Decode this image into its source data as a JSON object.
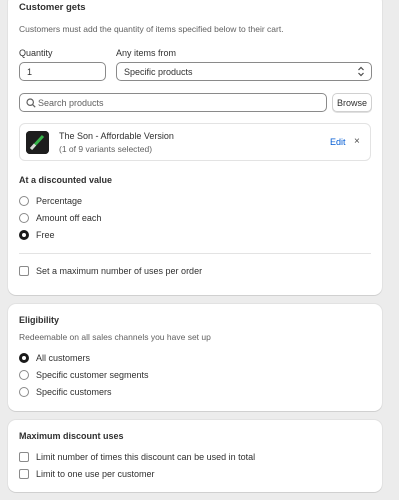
{
  "customer_gets": {
    "title": "Customer gets",
    "description": "Customers must add the quantity of items specified below to their cart.",
    "quantity_label": "Quantity",
    "quantity_value": "1",
    "any_items_label": "Any items from",
    "any_items_value": "Specific products",
    "search_placeholder": "Search products",
    "browse_label": "Browse",
    "product": {
      "name": "The Son - Affordable Version",
      "variants": "(1 of 9 variants selected)",
      "edit_label": "Edit",
      "remove_symbol": "×"
    },
    "discounted_value_title": "At a discounted value",
    "options": [
      {
        "label": "Percentage",
        "selected": false
      },
      {
        "label": "Amount off each",
        "selected": false
      },
      {
        "label": "Free",
        "selected": true
      }
    ],
    "max_uses_per_order_label": "Set a maximum number of uses per order"
  },
  "eligibility": {
    "title": "Eligibility",
    "description": "Redeemable on all sales channels you have set up",
    "options": [
      {
        "label": "All customers",
        "selected": true
      },
      {
        "label": "Specific customer segments",
        "selected": false
      },
      {
        "label": "Specific customers",
        "selected": false
      }
    ]
  },
  "max_discount_uses": {
    "title": "Maximum discount uses",
    "options": [
      {
        "label": "Limit number of times this discount can be used in total",
        "checked": false
      },
      {
        "label": "Limit to one use per customer",
        "checked": false
      }
    ]
  },
  "icons": {
    "select": "chevron-up-down-icon",
    "search": "search-icon",
    "remove": "close-icon"
  },
  "colors": {
    "link": "#005bd3",
    "background": "#ececec",
    "card": "#ffffff"
  }
}
